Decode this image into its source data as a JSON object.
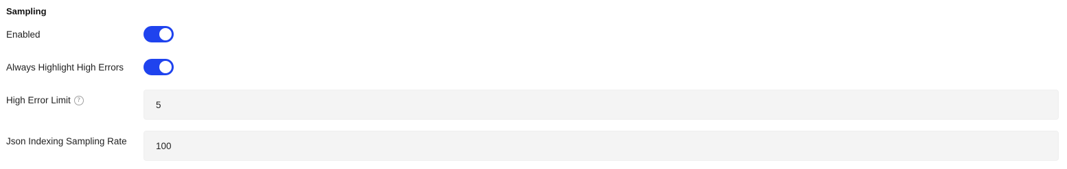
{
  "section": {
    "title": "Sampling"
  },
  "settings": {
    "enabled": {
      "label": "Enabled",
      "value": true
    },
    "always_highlight": {
      "label": "Always Highlight High Errors",
      "value": true
    },
    "high_error_limit": {
      "label": "High Error Limit",
      "value": "5",
      "help_icon": "question-circle-icon"
    },
    "json_sampling_rate": {
      "label": "Json Indexing Sampling Rate",
      "value": "100"
    }
  },
  "colors": {
    "toggle_on": "#1f43ee",
    "field_bg": "#f4f4f4"
  }
}
